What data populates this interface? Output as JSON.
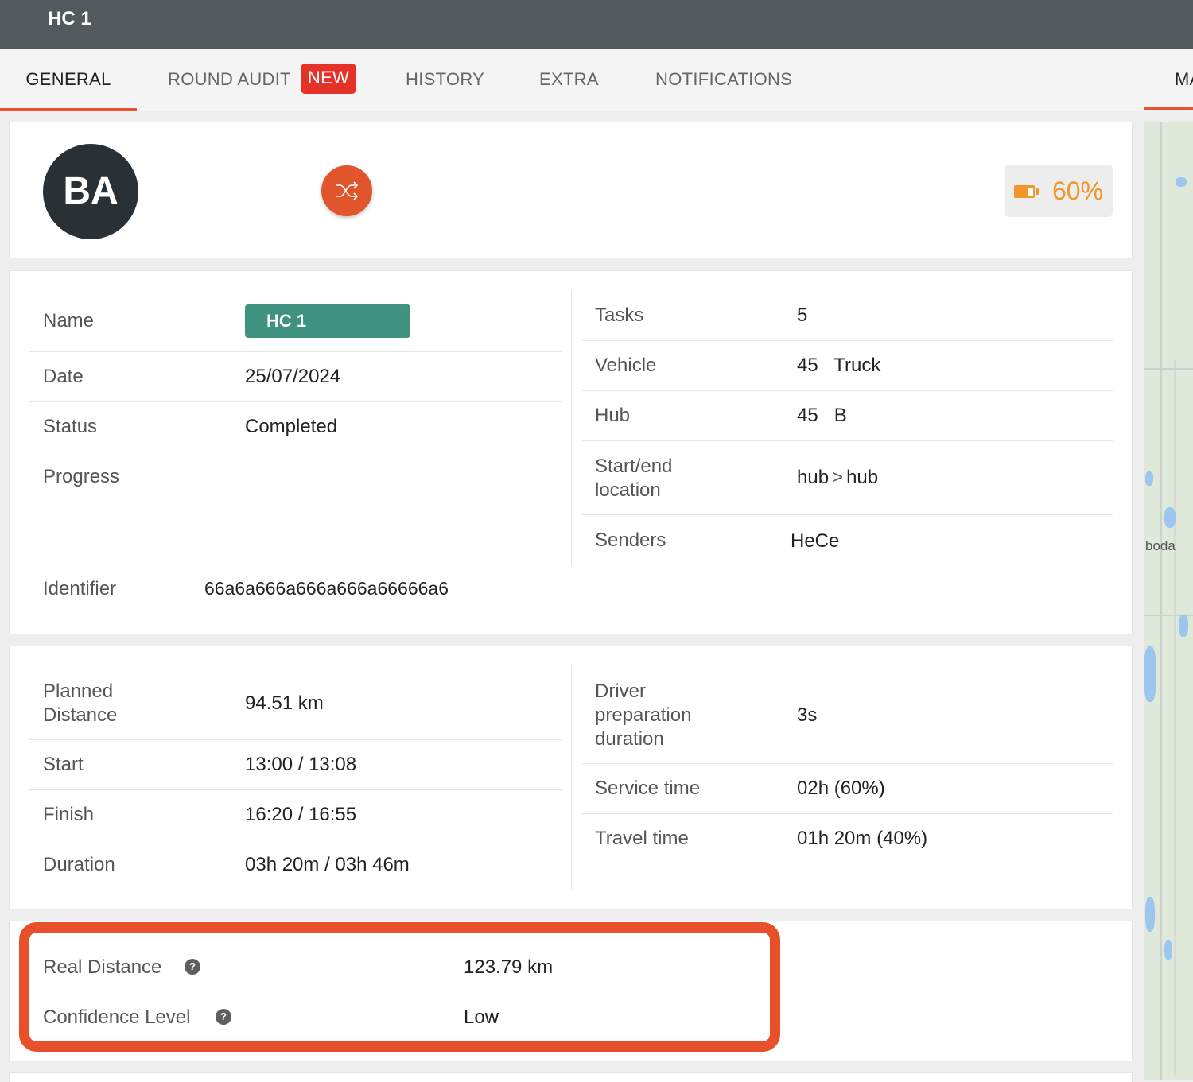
{
  "header": {
    "title": "HC 1"
  },
  "tabs": [
    {
      "label": "GENERAL"
    },
    {
      "label": "ROUND AUDIT",
      "badge": "NEW"
    },
    {
      "label": "HISTORY"
    },
    {
      "label": "EXTRA"
    },
    {
      "label": "NOTIFICATIONS"
    },
    {
      "label": "MA"
    }
  ],
  "profile": {
    "avatar_initials": "BA",
    "shuffle_icon": "shuffle-icon",
    "battery_icon": "battery-icon",
    "battery_percent": "60%",
    "colors": {
      "avatar": "#2a3136",
      "accent": "#e1552d",
      "battery": "#f0962a",
      "chip": "#3f9280"
    }
  },
  "details": {
    "left": [
      {
        "label": "Name",
        "value": "HC 1"
      },
      {
        "label": "Date",
        "value": "25/07/2024"
      },
      {
        "label": "Status",
        "value": "Completed"
      },
      {
        "label": "Progress",
        "value": ""
      },
      {
        "label": "Identifier",
        "value": "66a6a666a666a666a66666a6"
      }
    ],
    "right": [
      {
        "label": "Tasks",
        "value": "5"
      },
      {
        "label": "Vehicle",
        "value": "45   Truck"
      },
      {
        "label": "Hub",
        "value": "45   B"
      },
      {
        "label": "Start/end location",
        "from": "hub",
        "separator": ">",
        "to": "hub"
      },
      {
        "label": "Senders",
        "value": "HeCe"
      }
    ]
  },
  "timing": {
    "left": [
      {
        "label": "Planned Distance",
        "value": "94.51 km"
      },
      {
        "label": "Start",
        "value": "13:00 / 13:08"
      },
      {
        "label": "Finish",
        "value": "16:20 / 16:55"
      },
      {
        "label": "Duration",
        "value": "03h 20m / 03h 46m"
      }
    ],
    "right": [
      {
        "label": "Driver preparation duration",
        "value": "3s"
      },
      {
        "label": "Service time",
        "value": "02h (60%)"
      },
      {
        "label": "Travel time",
        "value": "01h 20m (40%)"
      }
    ]
  },
  "real": [
    {
      "label": "Real Distance",
      "value": "123.79 km",
      "help": "?"
    },
    {
      "label": "Confidence Level",
      "value": "Low",
      "help": "?"
    }
  ],
  "map": {
    "place_label": "boda"
  }
}
